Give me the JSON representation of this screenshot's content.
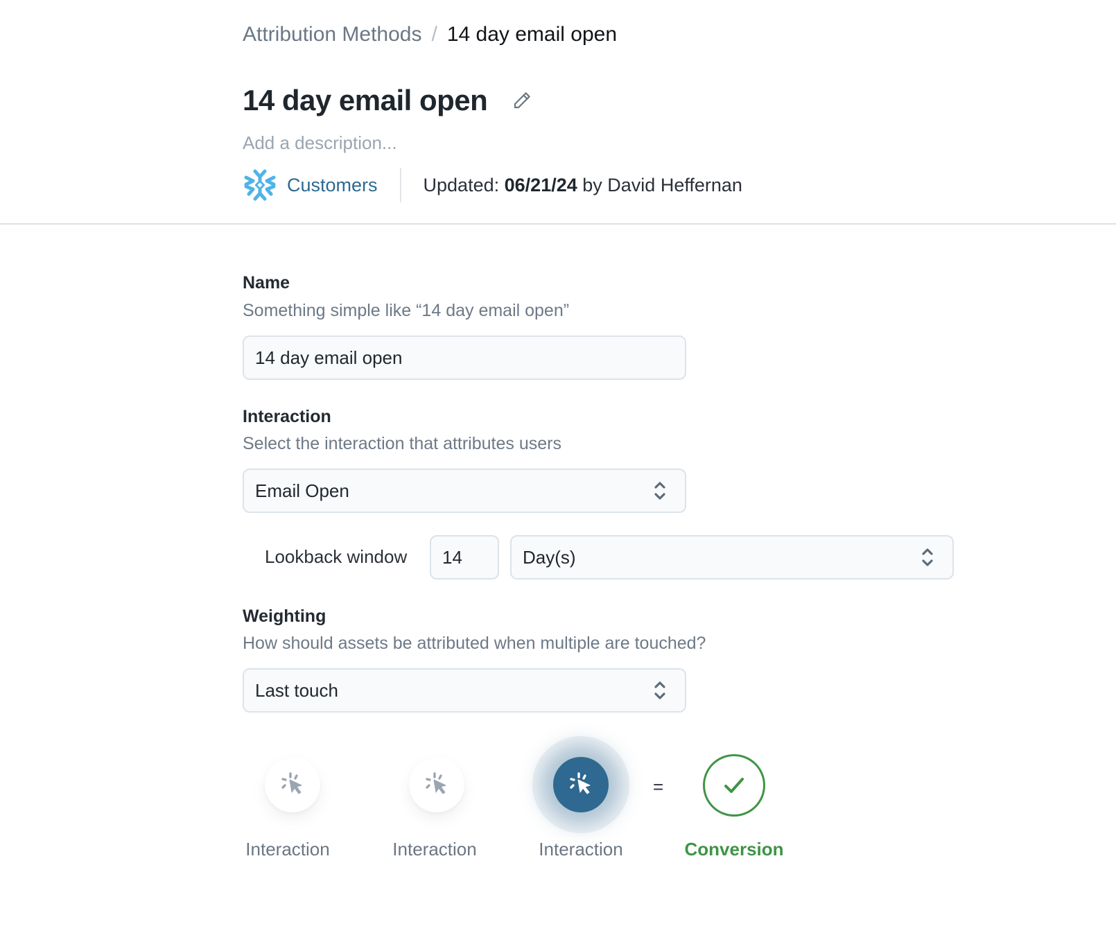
{
  "breadcrumb": {
    "parent": "Attribution Methods",
    "separator": "/",
    "current": "14 day email open"
  },
  "header": {
    "title": "14 day email open",
    "edit_icon": "pencil-icon",
    "description_placeholder": "Add a description...",
    "source": {
      "icon": "snowflake-icon",
      "label": "Customers",
      "color": "#2c6a91"
    },
    "updated_prefix": "Updated:",
    "updated_date": "06/21/24",
    "updated_by": "by David Heffernan"
  },
  "form": {
    "name": {
      "label": "Name",
      "help": "Something simple like “14 day email open”",
      "value": "14 day email open"
    },
    "interaction": {
      "label": "Interaction",
      "help": "Select the interaction that attributes users",
      "selected": "Email Open"
    },
    "lookback": {
      "label": "Lookback window",
      "value": "14",
      "unit_selected": "Day(s)"
    },
    "weighting": {
      "label": "Weighting",
      "help": "How should assets be attributed when multiple are touched?",
      "selected": "Last touch"
    }
  },
  "diagram": {
    "steps": [
      {
        "label": "Interaction",
        "icon": "click-cursor-icon",
        "active": false
      },
      {
        "label": "Interaction",
        "icon": "click-cursor-icon",
        "active": false
      },
      {
        "label": "Interaction",
        "icon": "click-cursor-icon",
        "active": true
      }
    ],
    "equals": "=",
    "result": {
      "label": "Conversion",
      "icon": "check-icon",
      "color": "#3f9445"
    },
    "active_color": "#2f6890"
  }
}
